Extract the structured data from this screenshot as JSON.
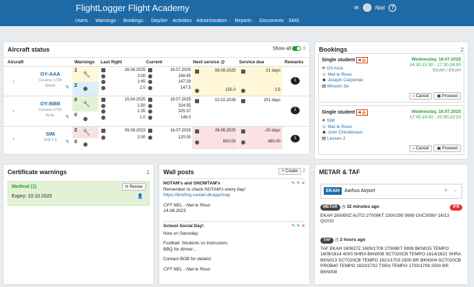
{
  "topbar": {
    "title": "FlightLogger Flight Academy",
    "user": "Niel",
    "help": "?"
  },
  "nav": [
    "Users ·",
    "Warnings ·",
    "Bookings ·",
    "Dep/Arr",
    "Activities",
    "Administration ·",
    "Reports ·",
    "Documents",
    "SMS"
  ],
  "aircraft": {
    "title": "Aircraft status",
    "show_all": "Show all",
    "count": "3",
    "headers": [
      "Aircraft",
      "Warnings",
      "Last flight",
      "Current",
      "Next service @",
      "Service due",
      "Remarks"
    ],
    "rows": [
      {
        "name": "OY-AAA",
        "model": "Cessna 172N",
        "base": "EKAH",
        "warn_top": "1",
        "warn_bot": "2",
        "last_date": "26.06.2025",
        "last_v": [
          "2:00",
          "1:45",
          "2.0"
        ],
        "cur_date": "16.07.2025",
        "cur_v": [
          "156:45",
          "147:29",
          "147.5"
        ],
        "next_date": "06.08.2025",
        "next_v": "150.0",
        "due_days": "21 days",
        "due_v": "2.5",
        "remark": "1"
      },
      {
        "name": "OY-BBB",
        "model": "Cessna 172N",
        "base": "KLAL",
        "warn_top": "0",
        "warn_bot": "0",
        "last_date": "15.04.2025",
        "last_v": [
          "1:50",
          "1:35",
          "1.0"
        ],
        "cur_date": "16.07.2025",
        "cur_v": [
          "324:55",
          "325:37",
          "146.0"
        ],
        "next_date": "02.02.2026",
        "next_v": "",
        "due_days": "201 days",
        "due_v": "",
        "remark": "1"
      },
      {
        "name": "SIM",
        "model": "FNPT II",
        "base": "",
        "warn_top": "2",
        "warn_bot": "0",
        "last_date": "09.08.2023",
        "last_v": [
          "2:00"
        ],
        "cur_date": "16.07.2025",
        "cur_v": [
          "120:00"
        ],
        "next_date": "26.06.2025",
        "next_v": "600.00",
        "due_days": "-20 days",
        "due_v": "480.00",
        "remark": "1"
      }
    ]
  },
  "bookings": {
    "title": "Bookings",
    "count": "2",
    "items": [
      {
        "type": "Single student",
        "date": "Wednesday, 16.07.2025",
        "time": "14:30,15:30 - 17:30,18:00",
        "route": "EKAH / EKAH",
        "aircraft": "OY-AAA",
        "student": "Niel le Roux",
        "instructor": "Joseph Carpenter",
        "lesson": "Mission 3a",
        "cancel": "Cancel",
        "proceed": "Proceed"
      },
      {
        "type": "Single student",
        "date": "Wednesday, 16.07.2025",
        "time": "17:45,18:00 - 22:00,22:10",
        "route": "",
        "aircraft": "SIM",
        "student": "Niel le Roux",
        "instructor": "John Christensen",
        "lesson": "Lesson 2",
        "cancel": "Cancel",
        "proceed": "Proceed"
      }
    ]
  },
  "certs": {
    "title": "Certificate warnings",
    "count": "1",
    "name": "Medical (1)",
    "renew": "Renew",
    "expiry": "Expiry: 10.10.2025"
  },
  "wall": {
    "title": "Wall posts",
    "create": "+ Create",
    "count": "2",
    "posts": [
      {
        "title": "NOTAM's and SNOWTAM's",
        "lines": [
          "Remember to check NOTAM's every day!",
          "https://briefing.naviair.dk/app/map"
        ],
        "author": "CPT NEL - Niel le Roux",
        "date": "14.08.2023"
      },
      {
        "title": "School Social Day!",
        "lines": [
          "Now on Saturday:",
          "",
          "Football: Students vs Instructors.",
          "BBQ for dinner...",
          "",
          "Contact BOB for details!"
        ],
        "author": "CPT NEL - Niel le Roux",
        "date": ""
      }
    ]
  },
  "metar": {
    "title": "METAR & TAF",
    "code": "EKAH",
    "airport": "Aarhus Airport",
    "metar_label": "METAR",
    "metar_age": "32 minutes ago",
    "ifr": "IFR",
    "metar_text": "EKAH 160950Z AUTO 27009KT 230V290 9999 OVC009/// 16/13 Q1010",
    "taf_label": "TAF",
    "taf_age": "2 hours ago",
    "taf_text": "TAF EKAH 160827Z 1609/1709 27008KT 9999 BKN015 TEMPO 1609/1614 4000 SHRA BKN008 SCT020CB TEMPO 1614/1621 SHRA BKN013 SCT020CB TEMPO 1621/1703 2500 BR BKN004 SCT020CB PROB40 TEMPO 1623/1702 TSRA TEMPO 1703/1709 2500 BR BKN008"
  },
  "colors": {
    "accent": "#1d6aa6",
    "green": "#2a9d3a",
    "red": "#e0302f"
  }
}
